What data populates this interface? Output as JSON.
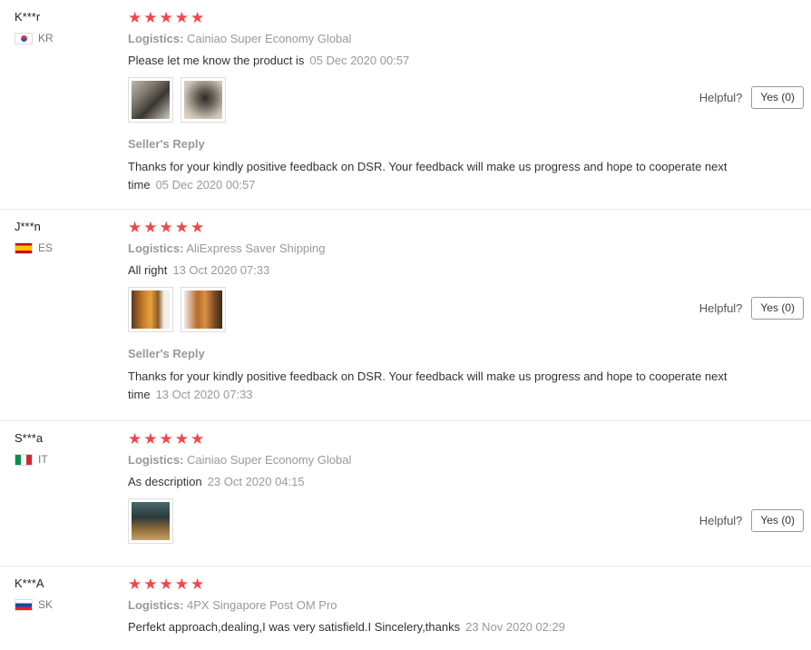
{
  "reviews": [
    {
      "user": "K***r",
      "country": "KR",
      "stars": "★★★★★",
      "logistics_label": "Logistics:",
      "logistics": "Cainiao Super Economy Global",
      "text": "Please let me know the product is",
      "time": "05 Dec 2020 00:57",
      "seller_label": "Seller's Reply",
      "reply_text": "Thanks for your kindly positive feedback on DSR. Your feedback will make us progress and hope to cooperate next time",
      "reply_time": "05 Dec 2020 00:57",
      "helpful_label": "Helpful?",
      "yes_label": "Yes (0)"
    },
    {
      "user": "J***n",
      "country": "ES",
      "stars": "★★★★★",
      "logistics_label": "Logistics:",
      "logistics": "AliExpress Saver Shipping",
      "text": "All right",
      "time": "13 Oct 2020 07:33",
      "seller_label": "Seller's Reply",
      "reply_text": "Thanks for your kindly positive feedback on DSR. Your feedback will make us progress and hope to cooperate next time",
      "reply_time": "13 Oct 2020 07:33",
      "helpful_label": "Helpful?",
      "yes_label": "Yes (0)"
    },
    {
      "user": "S***a",
      "country": "IT",
      "stars": "★★★★★",
      "logistics_label": "Logistics:",
      "logistics": "Cainiao Super Economy Global",
      "text": "As description",
      "time": "23 Oct 2020 04:15",
      "helpful_label": "Helpful?",
      "yes_label": "Yes (0)"
    },
    {
      "user": "K***A",
      "country": "SK",
      "stars": "★★★★★",
      "logistics_label": "Logistics:",
      "logistics": "4PX Singapore Post OM Pro",
      "text": "Perfekt approach,dealing,I was very satisfield.I Sincelery,thanks",
      "time": "23 Nov 2020 02:29"
    }
  ],
  "colors": {
    "star": "#f0484a",
    "muted": "#999999",
    "border": "#e8e8e8"
  }
}
